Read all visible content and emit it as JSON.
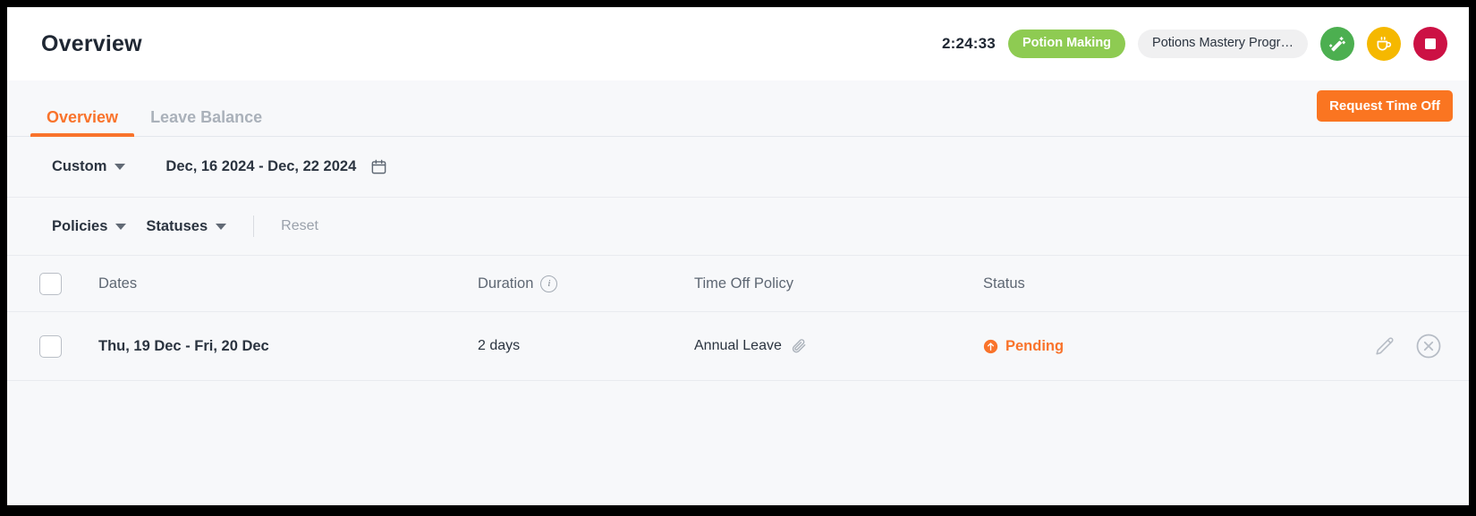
{
  "header": {
    "title": "Overview",
    "timer": "2:24:33",
    "task_pill": "Potion Making",
    "project_pill": "Potions Mastery Progr…",
    "buttons": [
      {
        "name": "magic-wand-button",
        "color": "#4caf50"
      },
      {
        "name": "coffee-break-button",
        "color": "#f5b800"
      },
      {
        "name": "stop-timer-button",
        "color": "#cc1144"
      }
    ]
  },
  "tabs": {
    "items": [
      {
        "label": "Overview",
        "active": true
      },
      {
        "label": "Leave Balance",
        "active": false
      }
    ],
    "request_button": "Request Time Off"
  },
  "filters": {
    "range_preset": "Custom",
    "date_range": "Dec, 16 2024 - Dec, 22 2024",
    "policies": "Policies",
    "statuses": "Statuses",
    "reset": "Reset"
  },
  "table": {
    "columns": {
      "dates": "Dates",
      "duration": "Duration",
      "policy": "Time Off Policy",
      "status": "Status"
    },
    "rows": [
      {
        "dates": "Thu, 19 Dec - Fri, 20 Dec",
        "duration": "2 days",
        "policy": "Annual Leave",
        "status": "Pending"
      }
    ]
  },
  "colors": {
    "accent": "#f9732b",
    "primary_button": "#fa7521",
    "task_pill": "#8ecb52",
    "stop": "#cc1144",
    "break": "#f5b800",
    "wand": "#4caf50"
  }
}
